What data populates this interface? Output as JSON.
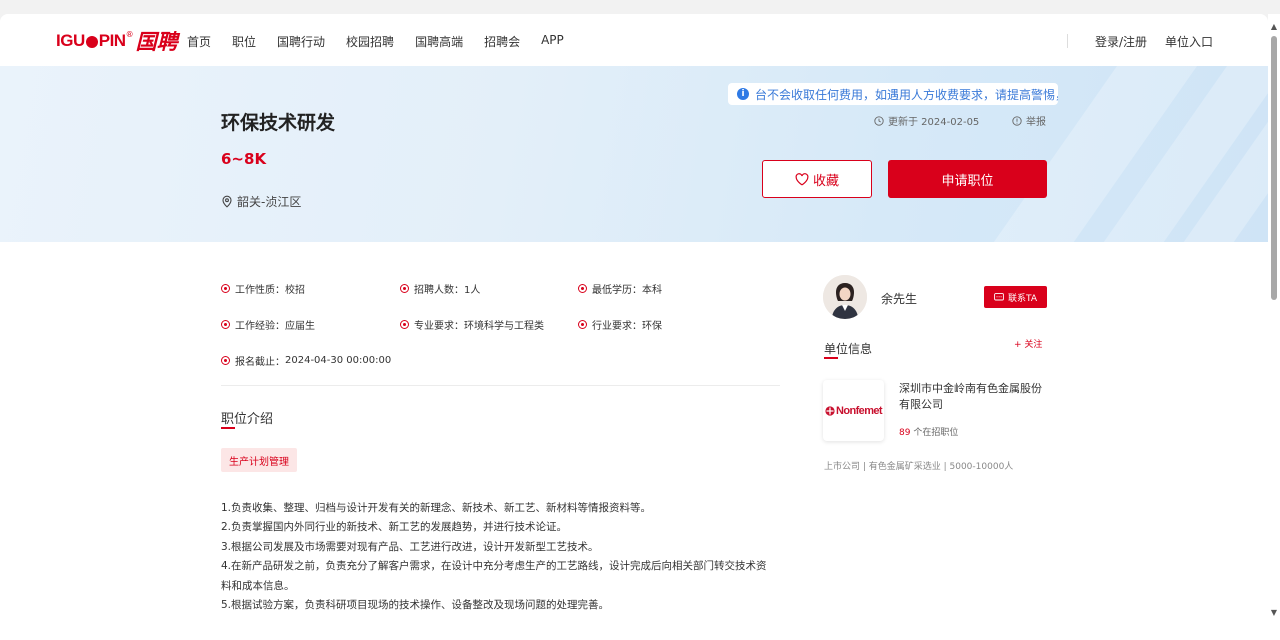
{
  "header": {
    "logo_latin": "IGU",
    "logo_latin_2": "PIN",
    "logo_cn": "国聘",
    "logo_reg": "®",
    "nav": [
      "首页",
      "职位",
      "国聘行动",
      "校园招聘",
      "国聘高端",
      "招聘会",
      "APP"
    ],
    "login": "登录/注册",
    "employer_entry": "单位入口"
  },
  "job": {
    "title": "环保技术研发",
    "salary": "6~8K",
    "location": "韶关-浈江区",
    "notice": "台不会收取任何费用，如遇用人方收费要求，请提高警惕，谨",
    "updated": "更新于 2024-02-05",
    "report": "举报",
    "favorite": "收藏",
    "apply": "申请职位"
  },
  "details": {
    "items": [
      {
        "label": "工作性质：",
        "value": "校招"
      },
      {
        "label": "招聘人数：",
        "value": "1人"
      },
      {
        "label": "最低学历：",
        "value": "本科"
      },
      {
        "label": "工作经验：",
        "value": "应届生"
      },
      {
        "label": "专业要求：",
        "value": "环境科学与工程类"
      },
      {
        "label": "行业要求：",
        "value": "环保"
      },
      {
        "label": "报名截止：",
        "value": "2024-04-30 00:00:00"
      }
    ]
  },
  "intro": {
    "heading": "职位介绍",
    "tag": "生产计划管理",
    "lines": [
      "1.负责收集、整理、归档与设计开发有关的新理念、新技术、新工艺、新材料等情报资料等。",
      "2.负责掌握国内外同行业的新技术、新工艺的发展趋势，并进行技术论证。",
      "3.根据公司发展及市场需要对现有产品、工艺进行改进，设计开发新型工艺技术。",
      "4.在新产品研发之前，负责充分了解客户需求，在设计中充分考虑生产的工艺路线，设计完成后向相关部门转交技术资料和成本信息。",
      "5.根据试验方案，负责科研项目现场的技术操作、设备整改及现场问题的处理完善。"
    ]
  },
  "contact": {
    "name": "余先生",
    "button": "联系TA"
  },
  "company": {
    "heading": "单位信息",
    "follow": "+ 关注",
    "logo_text": "Nonfemet",
    "name": "深圳市中金岭南有色金属股份有限公司",
    "job_count": "89",
    "job_count_suffix": " 个在招职位",
    "meta": "上市公司 | 有色金属矿采选业 | 5000-10000人"
  },
  "colors": {
    "brand_red": "#d9001b",
    "notice_blue": "#3a7ad8"
  }
}
